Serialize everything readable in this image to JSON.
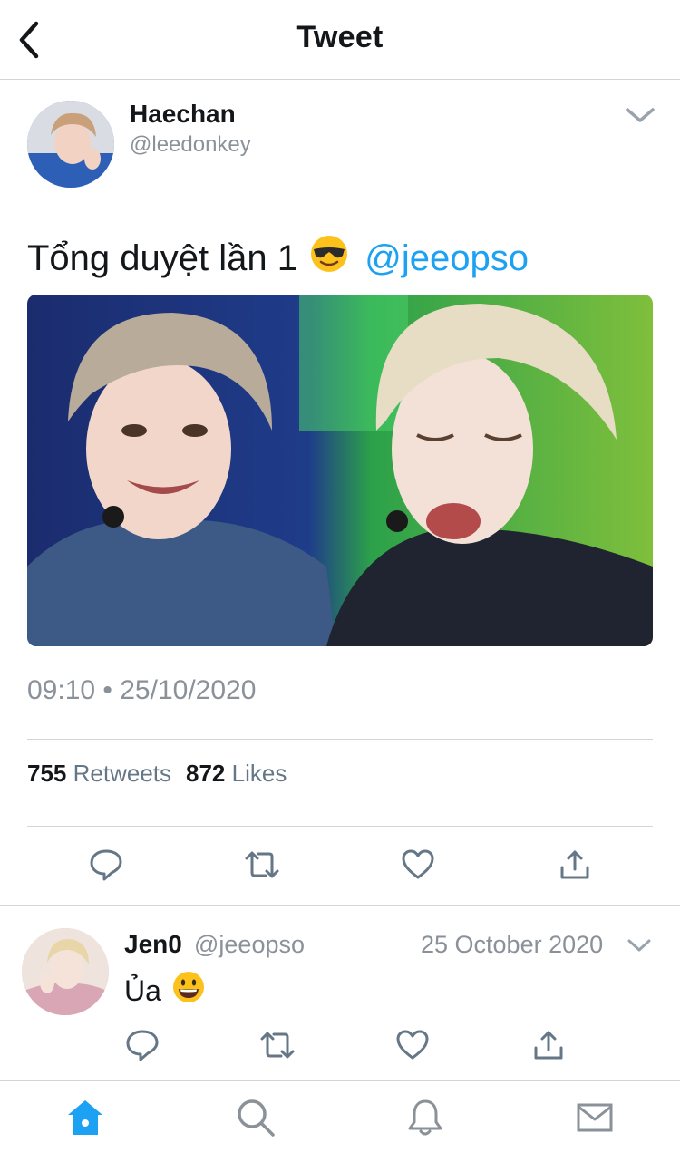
{
  "header": {
    "title": "Tweet"
  },
  "tweet": {
    "author_name": "Haechan",
    "author_handle": "@leedonkey",
    "text": "Tổng duyệt lần 1",
    "mention": "@jeeopso",
    "timestamp": "09:10 • 25/10/2020",
    "retweets_count": "755",
    "retweets_label": "Retweets",
    "likes_count": "872",
    "likes_label": "Likes"
  },
  "reply": {
    "author_name": "Jen0",
    "author_handle": "@jeeopso",
    "date": "25 October 2020",
    "text": "Ủa"
  },
  "colors": {
    "accent": "#1da1f2",
    "icon": "#657786",
    "text": "#14171a",
    "muted": "#8a9199"
  },
  "icons": {
    "back": "back-chevron-icon",
    "caret": "chevron-down-icon",
    "reply": "reply-bubble-icon",
    "retweet": "retweet-icon",
    "like": "heart-icon",
    "share": "share-icon",
    "tabs": [
      "home-icon",
      "search-icon",
      "notifications-bell-icon",
      "messages-envelope-icon"
    ]
  }
}
